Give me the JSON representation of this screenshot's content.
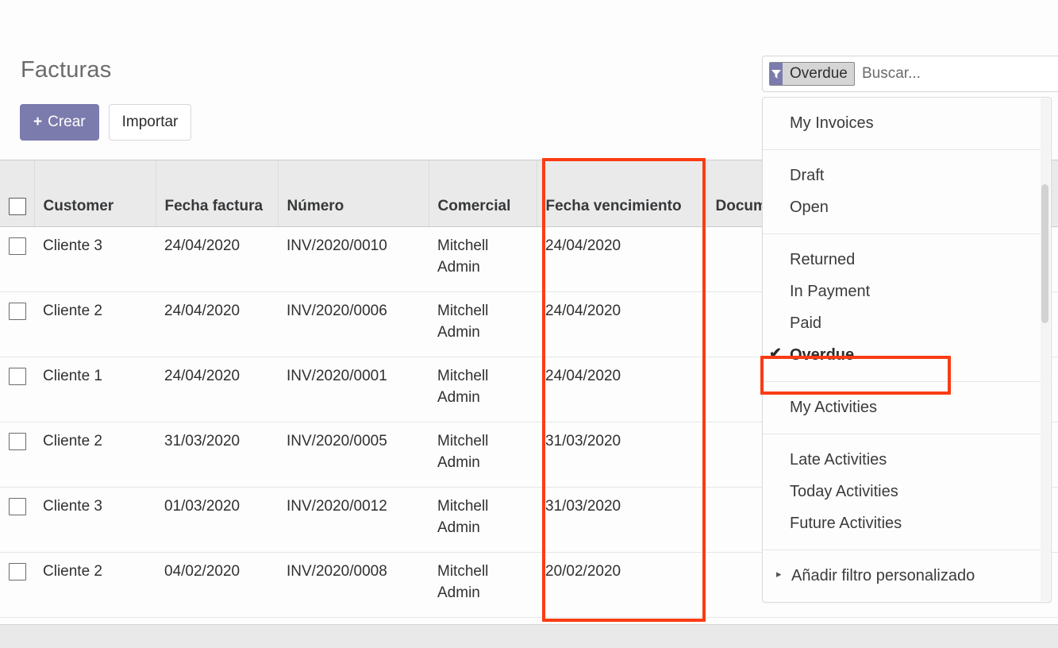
{
  "page": {
    "title": "Facturas"
  },
  "toolbar": {
    "create_label": "Crear",
    "create_icon_glyph": "+",
    "import_label": "Importar"
  },
  "search": {
    "facet_label": "Overdue",
    "facet_remove_glyph": "✖",
    "facet_icon": "filter-icon",
    "placeholder": "Buscar..."
  },
  "dropdown": {
    "groups": [
      {
        "items": [
          {
            "label": "My Invoices",
            "selected": false,
            "caret": false
          }
        ]
      },
      {
        "items": [
          {
            "label": "Draft",
            "selected": false,
            "caret": false
          },
          {
            "label": "Open",
            "selected": false,
            "caret": false
          }
        ]
      },
      {
        "items": [
          {
            "label": "Returned",
            "selected": false,
            "caret": false
          },
          {
            "label": "In Payment",
            "selected": false,
            "caret": false
          },
          {
            "label": "Paid",
            "selected": false,
            "caret": false
          },
          {
            "label": "Overdue",
            "selected": true,
            "caret": false
          }
        ]
      },
      {
        "items": [
          {
            "label": "My Activities",
            "selected": false,
            "caret": false
          }
        ]
      },
      {
        "items": [
          {
            "label": "Late Activities",
            "selected": false,
            "caret": false
          },
          {
            "label": "Today Activities",
            "selected": false,
            "caret": false
          },
          {
            "label": "Future Activities",
            "selected": false,
            "caret": false
          }
        ]
      },
      {
        "items": [
          {
            "label": "Añadir filtro personalizado",
            "selected": false,
            "caret": true
          }
        ]
      }
    ],
    "selected_tick_glyph": "✔",
    "caret_glyph": "▸"
  },
  "table": {
    "columns": [
      {
        "key": "checkbox",
        "label": ""
      },
      {
        "key": "customer",
        "label": "Customer"
      },
      {
        "key": "fecha_factura",
        "label": "Fecha factura"
      },
      {
        "key": "numero",
        "label": "Número"
      },
      {
        "key": "comercial",
        "label": "Comercial"
      },
      {
        "key": "fecha_vencimiento",
        "label": "Fecha vencimiento"
      },
      {
        "key": "documento_origen",
        "label": "Documento origen"
      }
    ],
    "rows": [
      {
        "customer": "Cliente 3",
        "fecha_factura": "24/04/2020",
        "numero": "INV/2020/0010",
        "comercial": "Mitchell Admin",
        "fecha_vencimiento": "24/04/2020",
        "documento_origen": ""
      },
      {
        "customer": "Cliente 2",
        "fecha_factura": "24/04/2020",
        "numero": "INV/2020/0006",
        "comercial": "Mitchell Admin",
        "fecha_vencimiento": "24/04/2020",
        "documento_origen": ""
      },
      {
        "customer": "Cliente 1",
        "fecha_factura": "24/04/2020",
        "numero": "INV/2020/0001",
        "comercial": "Mitchell Admin",
        "fecha_vencimiento": "24/04/2020",
        "documento_origen": ""
      },
      {
        "customer": "Cliente 2",
        "fecha_factura": "31/03/2020",
        "numero": "INV/2020/0005",
        "comercial": "Mitchell Admin",
        "fecha_vencimiento": "31/03/2020",
        "documento_origen": ""
      },
      {
        "customer": "Cliente 3",
        "fecha_factura": "01/03/2020",
        "numero": "INV/2020/0012",
        "comercial": "Mitchell Admin",
        "fecha_vencimiento": "31/03/2020",
        "documento_origen": ""
      },
      {
        "customer": "Cliente 2",
        "fecha_factura": "04/02/2020",
        "numero": "INV/2020/0008",
        "comercial": "Mitchell Admin",
        "fecha_vencimiento": "20/02/2020",
        "documento_origen": ""
      }
    ]
  },
  "annotations": {
    "column_highlight_color": "#fa3c14",
    "menu_item_highlight_color": "#fa3c14"
  },
  "colors": {
    "accent": "#7c7bad",
    "header_bg": "#eaeaea",
    "row_bg": "#fdfdfd"
  }
}
